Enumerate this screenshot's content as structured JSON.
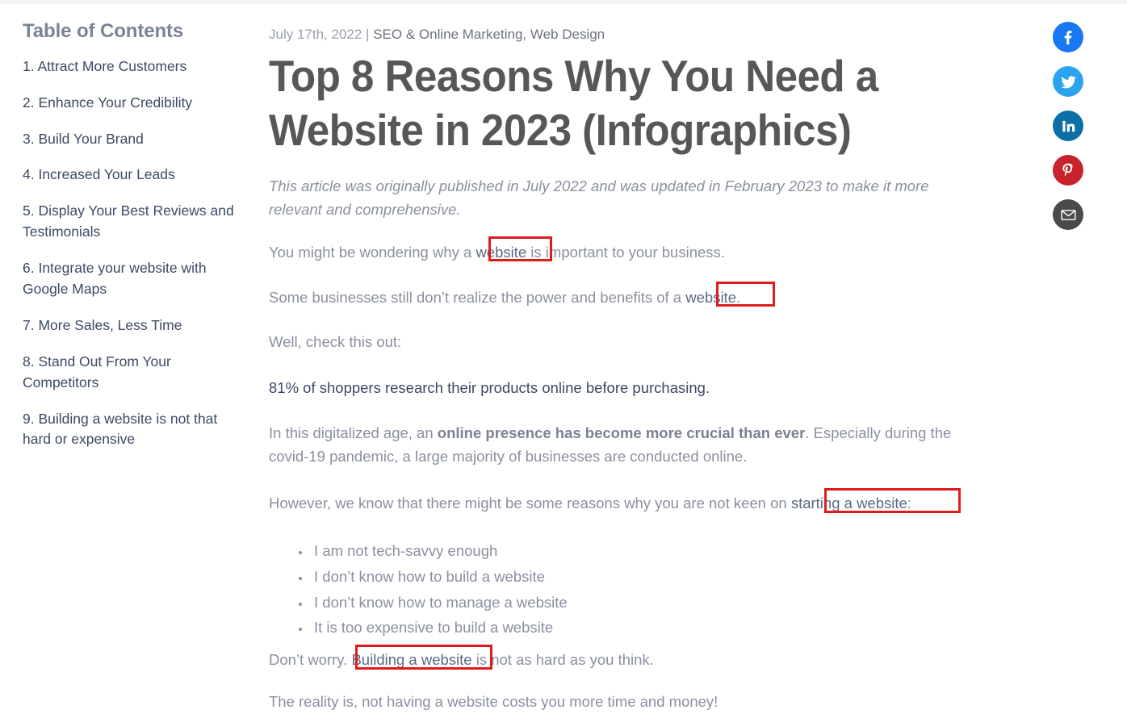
{
  "article": {
    "date": "July 17th, 2022",
    "separator": "|",
    "categories": "SEO & Online Marketing, Web Design",
    "title": "Top 8 Reasons Why You Need a Website in 2023 (Infographics)",
    "intro": "This article was originally published in July 2022 and was updated in February 2023 to make it more relevant and comprehensive.",
    "paragraphs": {
      "p1_before": "You might be wondering why a ",
      "p1_link": "website",
      "p1_after": " is important to your business.",
      "p2_before": "Some businesses still don’t realize the power and benefits of a ",
      "p2_link": "website",
      "p2_after": ".",
      "p3": "Well, check this out:",
      "p4_stat": "81% of shoppers research their products online before purchasing.",
      "p5_before": "In this digitalized age, an ",
      "p5_bold": "online presence has become more crucial than ever",
      "p5_after": ". Especially during the covid-19 pandemic, a large majority of businesses are conducted online.",
      "p6_before": "However, we know that there might be some reasons why you are not keen on ",
      "p6_link": "starting a website",
      "p6_after": ":",
      "p7_before": "Don’t worry. ",
      "p7_link": "Building a website",
      "p7_after": " is not as hard as you think.",
      "p8": "The reality is, not having a website costs you more time and money!"
    },
    "bullets": [
      "I am not tech-savvy enough",
      "I don’t know how to build a website",
      "I don’t know how to manage a website",
      "It is too expensive to build a website"
    ]
  },
  "toc": {
    "heading": "Table of Contents",
    "items": [
      {
        "label": "1. Attract More Customers"
      },
      {
        "label": "2. Enhance Your Credibility"
      },
      {
        "label": "3. Build Your Brand"
      },
      {
        "label": "4. Increased Your Leads"
      },
      {
        "label": "5. Display Your Best Reviews and Testimonials"
      },
      {
        "label": "6. Integrate your website with Google Maps"
      },
      {
        "label": "7. More Sales, Less Time"
      },
      {
        "label": "8. Stand Out From Your Competitors"
      },
      {
        "label": "9. Building a website is not that hard or expensive"
      }
    ]
  },
  "social": {
    "items": [
      {
        "name": "facebook-share-button",
        "icon": "facebook-icon",
        "label": "Share on Facebook",
        "color": "#1877F2"
      },
      {
        "name": "twitter-share-button",
        "icon": "twitter-icon",
        "label": "Share on Twitter",
        "color": "#2BA3EF"
      },
      {
        "name": "linkedin-share-button",
        "icon": "linkedin-icon",
        "label": "Share on LinkedIn",
        "color": "#0C6FA5"
      },
      {
        "name": "pinterest-share-button",
        "icon": "pinterest-icon",
        "label": "Save to Pinterest",
        "color": "#C8232C"
      },
      {
        "name": "email-share-button",
        "icon": "envelope-icon",
        "label": "Share by Email",
        "color": "#4A4A4A"
      }
    ]
  },
  "annotations": {
    "highlight_color": "#e01b1b",
    "boxes": [
      {
        "target": "website-link-1"
      },
      {
        "target": "website-link-2"
      },
      {
        "target": "starting-a-website-link"
      },
      {
        "target": "building-a-website-link"
      }
    ]
  },
  "colors": {
    "body_text": "#8b90a0",
    "link_text": "#3c4a63",
    "title_text": "#575757",
    "meta_text": "#9aa0ab",
    "background": "#ffffff"
  }
}
